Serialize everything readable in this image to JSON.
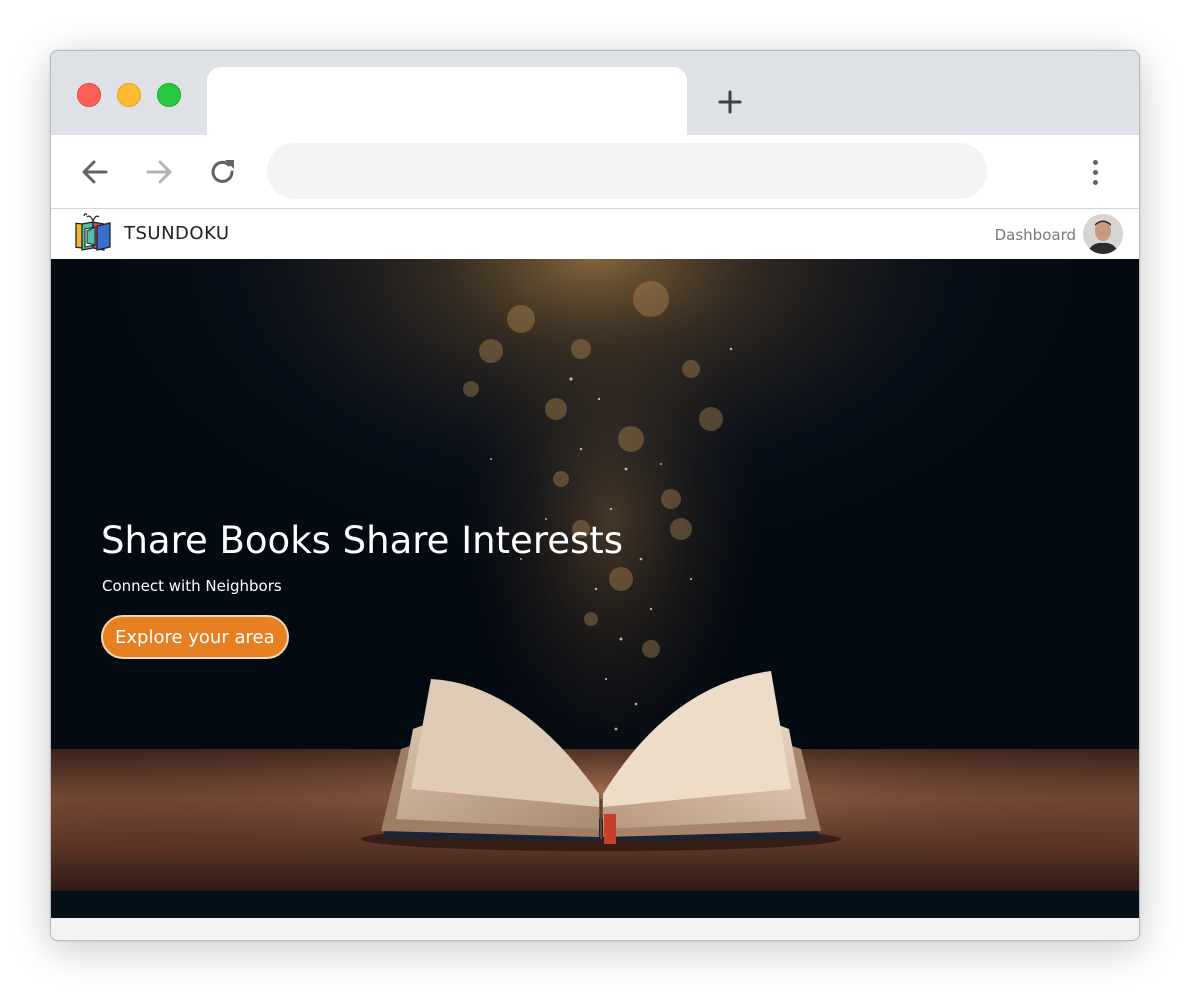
{
  "browser": {
    "tab_title": "",
    "address": "",
    "new_tab_icon": "plus-icon",
    "back_icon": "arrow-left-icon",
    "forward_icon": "arrow-right-icon",
    "reload_icon": "reload-icon",
    "menu_icon": "kebab-menu-icon"
  },
  "site": {
    "brand": "TSUNDOKU",
    "nav": {
      "dashboard_label": "Dashboard"
    }
  },
  "hero": {
    "title": "Share Books Share Interests",
    "subtitle": "Connect with Neighbors",
    "cta_label": "Explore your area"
  },
  "colors": {
    "accent": "#e68023",
    "accent_border": "#f6d9b3",
    "tab_strip": "#dee1e6",
    "omnibox": "#f1f3f4",
    "hero_dark": "#040a12"
  }
}
